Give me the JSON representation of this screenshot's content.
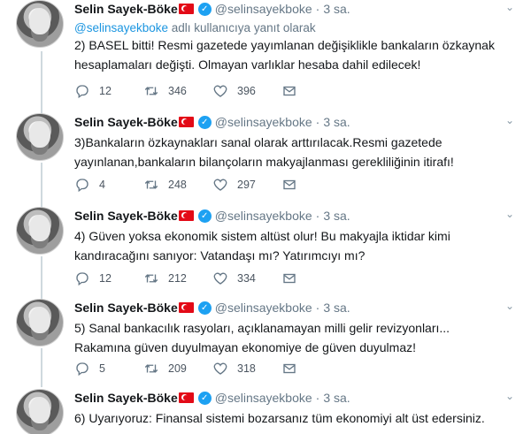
{
  "tweets": [
    {
      "name": "Selin Sayek-Böke",
      "handle": "@selinsayekboke",
      "time": "3 sa.",
      "reply_to_prefix": "@selinsayekboke",
      "reply_to_suffix": " adlı kullanıcıya yanıt olarak",
      "text": "2) BASEL bitti!  Resmi gazetede yayımlanan değişiklikle bankaların özkaynak hesaplamaları değişti. Olmayan varlıklar hesaba dahil edilecek!",
      "replies": "12",
      "retweets": "346",
      "likes": "396"
    },
    {
      "name": "Selin Sayek-Böke",
      "handle": "@selinsayekboke",
      "time": "3 sa.",
      "text": "3)Bankaların özkaynakları sanal olarak arttırılacak.Resmi gazetede yayınlanan,bankaların bilançoların makyajlanması gerekliliğinin itirafı!",
      "replies": "4",
      "retweets": "248",
      "likes": "297"
    },
    {
      "name": "Selin Sayek-Böke",
      "handle": "@selinsayekboke",
      "time": "3 sa.",
      "text": "4) Güven yoksa ekonomik sistem altüst olur! Bu makyajla iktidar kimi kandıracağını sanıyor: Vatandaşı mı? Yatırımcıyı mı?",
      "replies": "12",
      "retweets": "212",
      "likes": "334"
    },
    {
      "name": "Selin Sayek-Böke",
      "handle": "@selinsayekboke",
      "time": "3 sa.",
      "text": "5) Sanal bankacılık rasyoları, açıklanamayan milli gelir revizyonları... Rakamına güven duyulmayan ekonomiye de güven duyulmaz!",
      "replies": "5",
      "retweets": "209",
      "likes": "318"
    },
    {
      "name": "Selin Sayek-Böke",
      "handle": "@selinsayekboke",
      "time": "3 sa.",
      "text": "6) Uyarıyoruz: Finansal sistemi bozarsanız tüm ekonomiyi alt üst edersiniz."
    }
  ],
  "icons": {
    "reply": "reply-icon",
    "retweet": "retweet-icon",
    "like": "heart-icon",
    "dm": "envelope-icon",
    "menu": "chevron-down-icon",
    "verified": "verified-badge-icon",
    "flag": "turkey-flag-icon"
  },
  "colors": {
    "link": "#1b95e0",
    "muted": "#657786",
    "verified": "#1da1f2",
    "flag": "#e30a17"
  }
}
